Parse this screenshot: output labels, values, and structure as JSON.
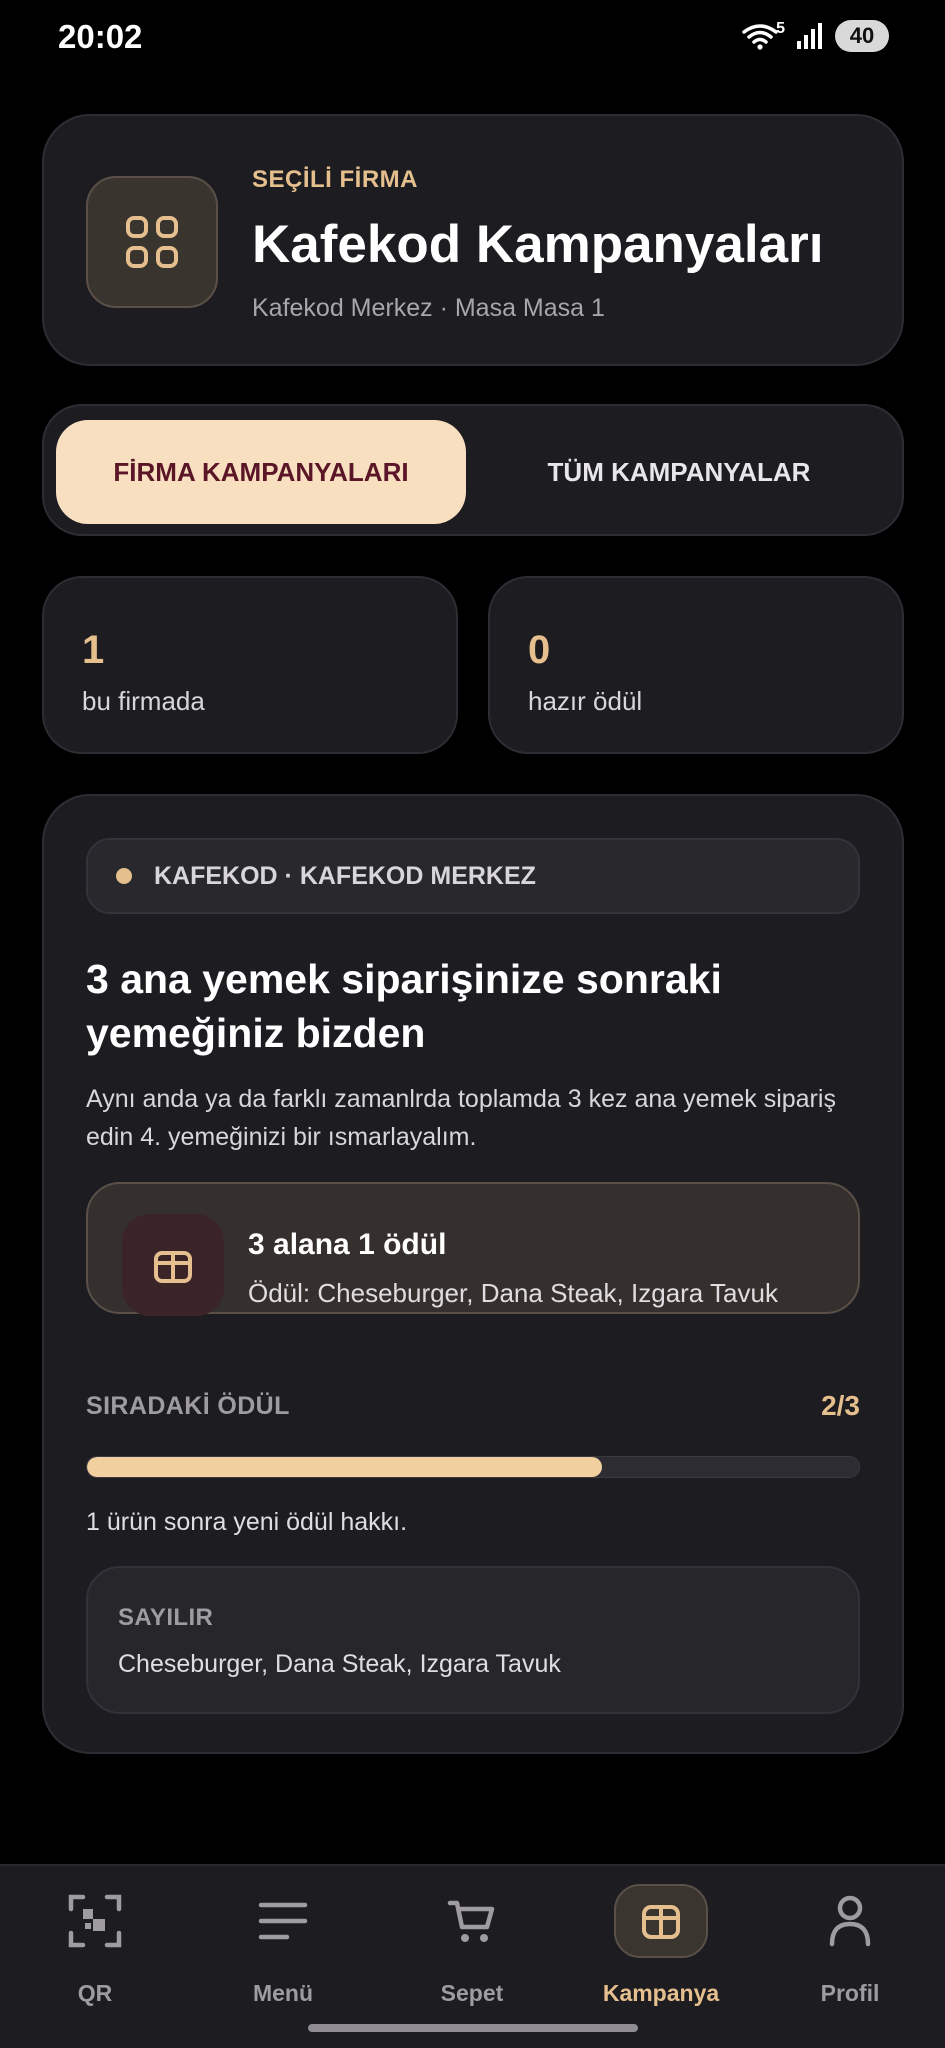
{
  "status_bar": {
    "time": "20:02",
    "battery": "40",
    "wifi_label": "5"
  },
  "company": {
    "label": "SEÇİLİ FİRMA",
    "title": "Kafekod Kampanyaları",
    "subtitle": "Kafekod Merkez · Masa Masa 1",
    "icon": "grid-icon"
  },
  "tabs": [
    {
      "label": "FİRMA KAMPANYALARI",
      "active": true
    },
    {
      "label": "TÜM KAMPANYALAR",
      "active": false
    }
  ],
  "stats": [
    {
      "value": "1",
      "label": "bu firmada"
    },
    {
      "value": "0",
      "label": "hazır ödül"
    }
  ],
  "campaign": {
    "firm_chip": "KAFEKOD · KAFEKOD MERKEZ",
    "title": "3 ana yemek siparişinize sonraki yemeğiniz bizden",
    "description": "Aynı anda ya da farklı zamanlrda toplamda 3 kez ana yemek sipariş edin 4. yemeğinizi bir ısmarlayalım.",
    "reward_title": "3 alana 1 ödül",
    "reward_sub": "Ödül: Cheseburger, Dana Steak, Izgara Tavuk",
    "next_label": "SIRADAKİ ÖDÜL",
    "next_count": "2/3",
    "progress_fraction": 0.667,
    "progress_note": "1 ürün sonra yeni ödül hakkı.",
    "counts_label": "SAYILIR",
    "counts_value": "Cheseburger, Dana Steak, Izgara Tavuk"
  },
  "nav": [
    {
      "label": "QR",
      "icon": "qr-scan-icon",
      "active": false
    },
    {
      "label": "Menü",
      "icon": "menu-icon",
      "active": false
    },
    {
      "label": "Sepet",
      "icon": "cart-icon",
      "active": false
    },
    {
      "label": "Kampanya",
      "icon": "gift-icon",
      "active": true
    },
    {
      "label": "Profil",
      "icon": "profile-icon",
      "active": false
    }
  ],
  "colors": {
    "accent": "#e6bf8e",
    "tab_active_bg": "#f7dfc0",
    "tab_active_text": "#5a1526",
    "background": "#000000",
    "card": "#1d1c20"
  }
}
